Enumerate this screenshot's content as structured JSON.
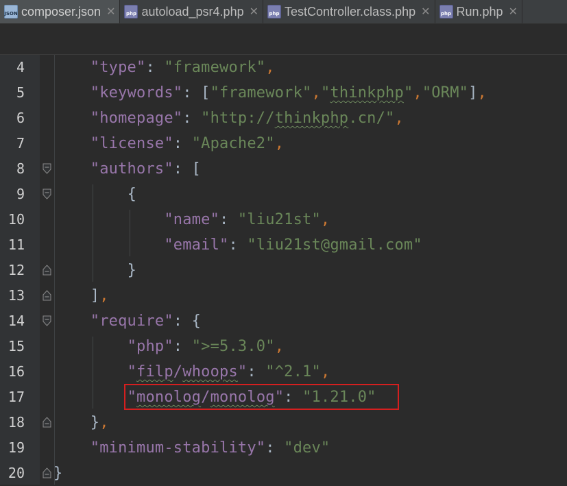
{
  "tabs": [
    {
      "label": "composer.json",
      "icon": "json-file-icon",
      "icon_text": "JSON",
      "active": true
    },
    {
      "label": "autoload_psr4.php",
      "icon": "php-file-icon",
      "icon_text": "php",
      "active": false
    },
    {
      "label": "TestController.class.php",
      "icon": "php-file-icon",
      "icon_text": "php",
      "active": false
    },
    {
      "label": "Run.php",
      "icon": "php-file-icon",
      "icon_text": "php",
      "active": false
    }
  ],
  "close_glyph": "✕",
  "colors": {
    "key": "#9876aa",
    "string": "#6a8759",
    "punctuation": "#cc7832",
    "highlight": "#d51f1f"
  },
  "editor": {
    "lines": [
      {
        "num": "4",
        "fold": "",
        "indent": 1,
        "tokens": [
          [
            "key",
            "\"type\""
          ],
          [
            "plain",
            ": "
          ],
          [
            "str",
            "\"framework\""
          ],
          [
            "punc",
            ","
          ]
        ]
      },
      {
        "num": "5",
        "fold": "",
        "indent": 1,
        "tokens": [
          [
            "key",
            "\"keywords\""
          ],
          [
            "plain",
            ": ["
          ],
          [
            "str",
            "\"framework\""
          ],
          [
            "punc",
            ","
          ],
          [
            "str",
            "\"thinkphp\""
          ],
          [
            "punc",
            ","
          ],
          [
            "str",
            "\"ORM\""
          ],
          [
            "plain",
            "]"
          ],
          [
            "punc",
            ","
          ]
        ]
      },
      {
        "num": "6",
        "fold": "",
        "indent": 1,
        "tokens": [
          [
            "key",
            "\"homepage\""
          ],
          [
            "plain",
            ": "
          ],
          [
            "str",
            "\"http://thinkphp.cn/\""
          ],
          [
            "punc",
            ","
          ]
        ]
      },
      {
        "num": "7",
        "fold": "",
        "indent": 1,
        "tokens": [
          [
            "key",
            "\"license\""
          ],
          [
            "plain",
            ": "
          ],
          [
            "str",
            "\"Apache2\""
          ],
          [
            "punc",
            ","
          ]
        ]
      },
      {
        "num": "8",
        "fold": "open",
        "indent": 1,
        "tokens": [
          [
            "key",
            "\"authors\""
          ],
          [
            "plain",
            ": ["
          ]
        ]
      },
      {
        "num": "9",
        "fold": "open",
        "indent": 2,
        "tokens": [
          [
            "plain",
            "{"
          ]
        ]
      },
      {
        "num": "10",
        "fold": "",
        "indent": 3,
        "tokens": [
          [
            "key",
            "\"name\""
          ],
          [
            "plain",
            ": "
          ],
          [
            "str",
            "\"liu21st\""
          ],
          [
            "punc",
            ","
          ]
        ]
      },
      {
        "num": "11",
        "fold": "",
        "indent": 3,
        "tokens": [
          [
            "key",
            "\"email\""
          ],
          [
            "plain",
            ": "
          ],
          [
            "str",
            "\"liu21st@gmail.com\""
          ]
        ]
      },
      {
        "num": "12",
        "fold": "close",
        "indent": 2,
        "tokens": [
          [
            "plain",
            "}"
          ]
        ]
      },
      {
        "num": "13",
        "fold": "close",
        "indent": 1,
        "tokens": [
          [
            "plain",
            "]"
          ],
          [
            "punc",
            ","
          ]
        ]
      },
      {
        "num": "14",
        "fold": "open",
        "indent": 1,
        "tokens": [
          [
            "key",
            "\"require\""
          ],
          [
            "plain",
            ": {"
          ]
        ]
      },
      {
        "num": "15",
        "fold": "",
        "indent": 2,
        "tokens": [
          [
            "key",
            "\"php\""
          ],
          [
            "plain",
            ": "
          ],
          [
            "str",
            "\">=5.3.0\""
          ],
          [
            "punc",
            ","
          ]
        ]
      },
      {
        "num": "16",
        "fold": "",
        "indent": 2,
        "tokens": [
          [
            "key",
            "\"filp/whoops\""
          ],
          [
            "plain",
            ": "
          ],
          [
            "str",
            "\"^2.1\""
          ],
          [
            "punc",
            ","
          ]
        ]
      },
      {
        "num": "17",
        "fold": "",
        "indent": 2,
        "tokens": [
          [
            "key",
            "\"monolog/monolog\""
          ],
          [
            "plain",
            ": "
          ],
          [
            "str",
            "\"1.21.0\""
          ]
        ]
      },
      {
        "num": "18",
        "fold": "close",
        "indent": 1,
        "tokens": [
          [
            "plain",
            "}"
          ],
          [
            "punc",
            ","
          ]
        ]
      },
      {
        "num": "19",
        "fold": "",
        "indent": 1,
        "tokens": [
          [
            "key",
            "\"minimum-stability\""
          ],
          [
            "plain",
            ": "
          ],
          [
            "str",
            "\"dev\""
          ]
        ]
      },
      {
        "num": "20",
        "fold": "close",
        "indent": 0,
        "tokens": [
          [
            "plain",
            "}"
          ]
        ]
      }
    ],
    "squiggle_words": [
      "thinkphp",
      "filp",
      "whoops",
      "monolog"
    ]
  }
}
